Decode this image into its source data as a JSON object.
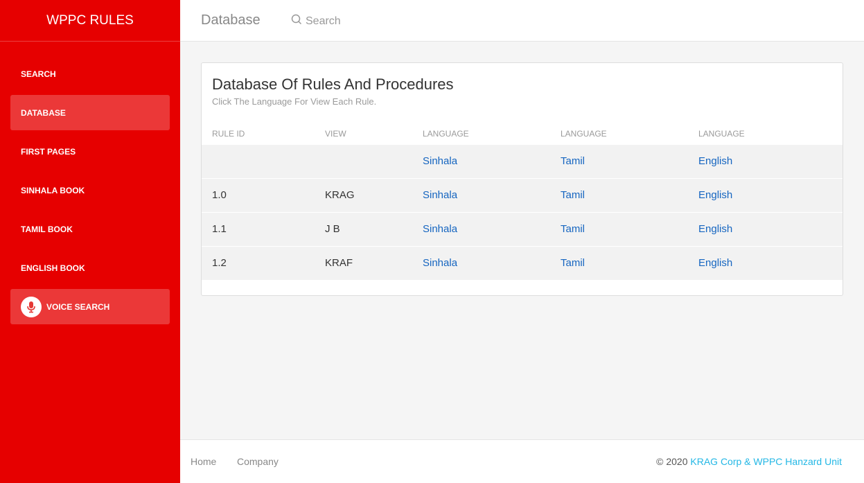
{
  "sidebar": {
    "brand": "WPPC RULES",
    "items": [
      {
        "label": "SEARCH"
      },
      {
        "label": "DATABASE"
      },
      {
        "label": "FIRST PAGES"
      },
      {
        "label": "SINHALA BOOK"
      },
      {
        "label": "TAMIL BOOK"
      },
      {
        "label": "ENGLISH BOOK"
      },
      {
        "label": "VOICE SEARCH"
      }
    ]
  },
  "topbar": {
    "title": "Database",
    "search_label": "Search"
  },
  "card": {
    "title": "Database Of Rules And Procedures",
    "subtitle": "Click The Language For View Each Rule.",
    "headers": [
      "RULE ID",
      "VIEW",
      "LANGUAGE",
      "LANGUAGE",
      "LANGUAGE"
    ],
    "rows": [
      {
        "id": "",
        "view": "",
        "sinhala": "Sinhala",
        "tamil": "Tamil",
        "english": "English"
      },
      {
        "id": "1.0",
        "view": "KRAG",
        "sinhala": "Sinhala",
        "tamil": "Tamil",
        "english": "English"
      },
      {
        "id": "1.1",
        "view": "J B",
        "sinhala": "Sinhala",
        "tamil": "Tamil",
        "english": "English"
      },
      {
        "id": "1.2",
        "view": "KRAF",
        "sinhala": "Sinhala",
        "tamil": "Tamil",
        "english": "English"
      }
    ]
  },
  "footer": {
    "home": "Home",
    "company": "Company",
    "copyright_prefix": "© 2020",
    "copyright_link": "KRAG Corp & WPPC Hanzard Unit"
  },
  "colors": {
    "sidebar_bg": "#e60000",
    "link": "#1565c0",
    "footer_link": "#23b7e5"
  }
}
